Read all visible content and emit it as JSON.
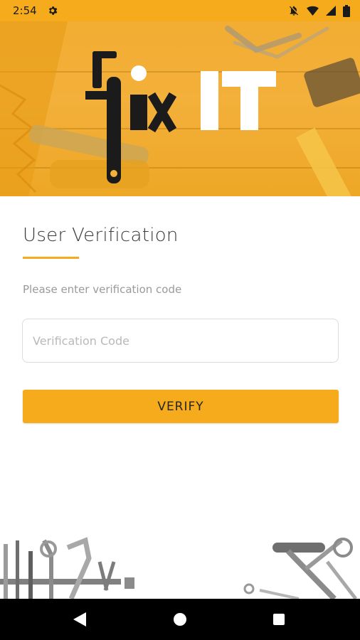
{
  "status_bar": {
    "time": "2:54",
    "icons": [
      "gear-icon",
      "notifications-off-icon",
      "wifi-icon",
      "signal-icon",
      "battery-icon"
    ]
  },
  "header": {
    "logo_text": "fixIT"
  },
  "verification": {
    "title": "User Verification",
    "subtitle": "Please enter verification code",
    "code_placeholder": "Verification Code",
    "code_value": "",
    "verify_label": "VERIFY"
  },
  "nav_bar": {
    "icons": [
      "back-icon",
      "home-icon",
      "recents-icon"
    ]
  },
  "colors": {
    "accent": "#f6ab1c",
    "nav_background": "#000000",
    "title_text": "#3a3a3a",
    "hint_text": "#9a9a9a"
  }
}
